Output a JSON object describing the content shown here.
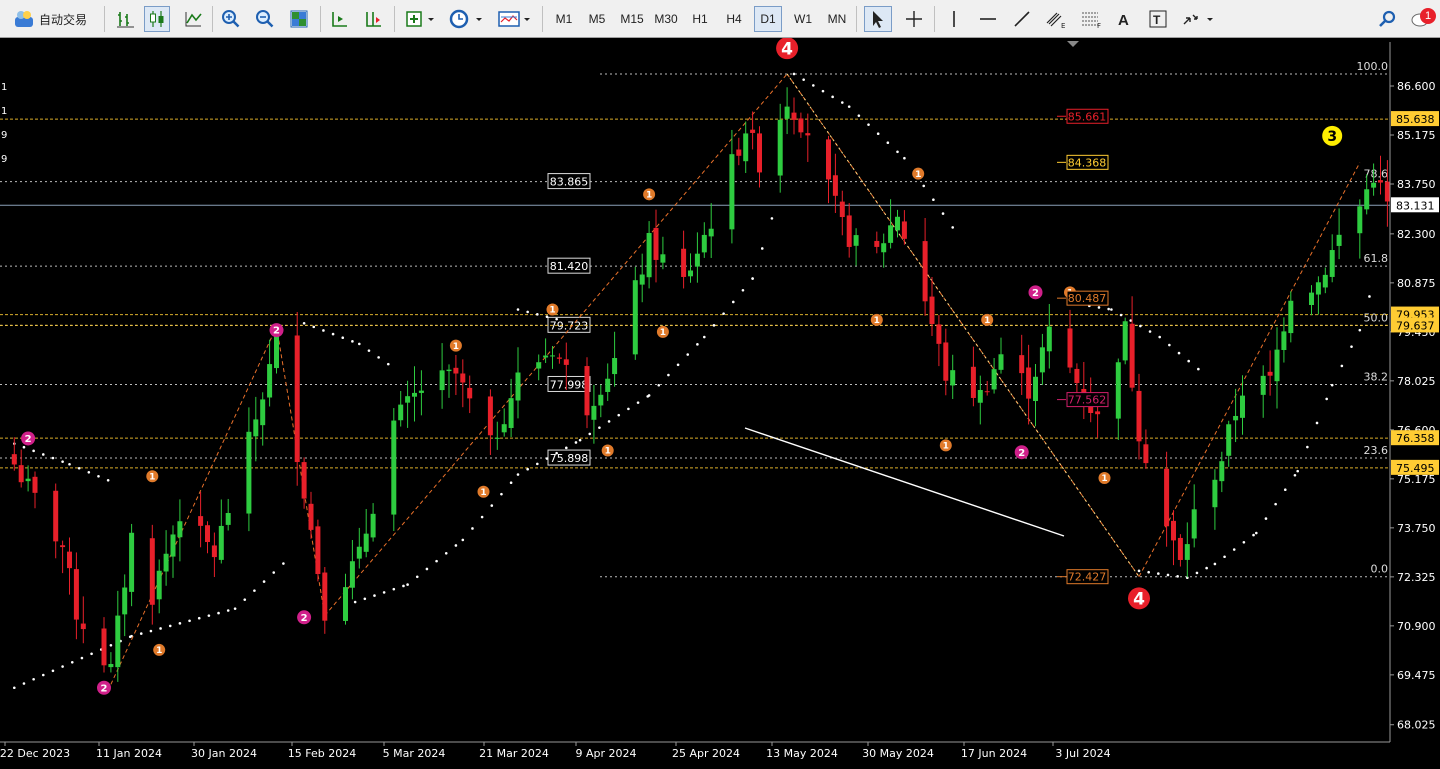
{
  "toolbar": {
    "auto_trading_label": "自动交易",
    "timeframes": [
      "M1",
      "M5",
      "M15",
      "M30",
      "H1",
      "H4",
      "D1",
      "W1",
      "MN"
    ],
    "active_timeframe": "D1",
    "alert_count": "1"
  },
  "colors": {
    "background": "#000000",
    "bull": "#2ecc40",
    "bear": "#e8202a",
    "grid_dotted": "#bbbbbb",
    "fib_line": "#ffcc33"
  },
  "left_edge_digits": [
    "1",
    "1",
    "9",
    "9"
  ],
  "price_axis": {
    "ticks": [
      "86.600",
      "85.175",
      "83.750",
      "82.300",
      "80.875",
      "79.450",
      "78.025",
      "76.600",
      "75.175",
      "73.750",
      "72.325",
      "70.900",
      "69.475",
      "68.025"
    ],
    "current_price": "83.131",
    "highlighted": [
      "85.638",
      "79.953",
      "79.637",
      "76.358",
      "75.495"
    ]
  },
  "time_axis": [
    "22 Dec 2023",
    "11 Jan 2024",
    "30 Jan 2024",
    "15 Feb 2024",
    "5 Mar 2024",
    "21 Mar 2024",
    "9 Apr 2024",
    "25 Apr 2024",
    "13 May 2024",
    "30 May 2024",
    "17 Jun 2024",
    "3 Jul 2024"
  ],
  "fibonacci": {
    "levels": [
      {
        "ratio": "100.0",
        "price": 86.95
      },
      {
        "ratio": "78.6",
        "price": 83.82
      },
      {
        "ratio": "61.8",
        "price": 81.36
      },
      {
        "ratio": "50.0",
        "price": 79.64
      },
      {
        "ratio": "38.2",
        "price": 77.92
      },
      {
        "ratio": "23.6",
        "price": 75.78
      },
      {
        "ratio": "0.0",
        "price": 72.33
      }
    ],
    "left_boxes": [
      "83.865",
      "81.420",
      "79.723",
      "77.998",
      "75.898"
    ]
  },
  "projection_labels": [
    {
      "text": "85.661",
      "price": 85.72,
      "color": "#e8202a"
    },
    {
      "text": "84.368",
      "price": 84.38,
      "color": "#ffcc33"
    },
    {
      "text": "80.487",
      "price": 80.43,
      "color": "#e07a2a"
    },
    {
      "text": "77.562",
      "price": 77.48,
      "color": "#d0206a"
    },
    {
      "text": "72.427",
      "price": 72.33,
      "color": "#e07a2a"
    }
  ],
  "wave_labels": [
    {
      "text": "4",
      "date": "2024-04-09",
      "price": 87.7,
      "size": "big"
    },
    {
      "text": "4",
      "date": "2024-05-30",
      "price": 71.7,
      "size": "big"
    },
    {
      "text": "3",
      "date": "2024-06-27",
      "price": 85.15,
      "size": "yellow"
    },
    {
      "text": "2",
      "date": "2023-12-21",
      "price": 76.35,
      "size": "pink"
    },
    {
      "text": "2",
      "date": "2024-01-26",
      "price": 79.5,
      "size": "pink"
    },
    {
      "text": "2",
      "date": "2024-01-30",
      "price": 71.15,
      "size": "pink"
    },
    {
      "text": "2",
      "date": "2024-01-01",
      "price": 69.1,
      "size": "pink"
    },
    {
      "text": "2",
      "date": "2024-05-15",
      "price": 80.6,
      "size": "pink"
    },
    {
      "text": "2",
      "date": "2024-05-13",
      "price": 75.95,
      "size": "pink"
    },
    {
      "text": "1",
      "date": "2024-01-08",
      "price": 75.25,
      "size": "small"
    },
    {
      "text": "1",
      "date": "2024-01-09",
      "price": 70.2,
      "size": "small"
    },
    {
      "text": "1",
      "date": "2024-02-21",
      "price": 79.05,
      "size": "small"
    },
    {
      "text": "1",
      "date": "2024-02-25",
      "price": 74.8,
      "size": "small"
    },
    {
      "text": "1",
      "date": "2024-03-06",
      "price": 80.1,
      "size": "small"
    },
    {
      "text": "1",
      "date": "2024-03-14",
      "price": 76.0,
      "size": "small"
    },
    {
      "text": "1",
      "date": "2024-03-20",
      "price": 83.45,
      "size": "small"
    },
    {
      "text": "1",
      "date": "2024-03-22",
      "price": 79.45,
      "size": "small"
    },
    {
      "text": "1",
      "date": "2024-04-28",
      "price": 84.05,
      "size": "small"
    },
    {
      "text": "1",
      "date": "2024-04-22",
      "price": 79.8,
      "size": "small"
    },
    {
      "text": "1",
      "date": "2024-05-02",
      "price": 76.15,
      "size": "small"
    },
    {
      "text": "1",
      "date": "2024-05-08",
      "price": 79.8,
      "size": "small"
    },
    {
      "text": "1",
      "date": "2024-05-20",
      "price": 80.6,
      "size": "small"
    },
    {
      "text": "1",
      "date": "2024-05-25",
      "price": 75.2,
      "size": "small"
    }
  ]
}
